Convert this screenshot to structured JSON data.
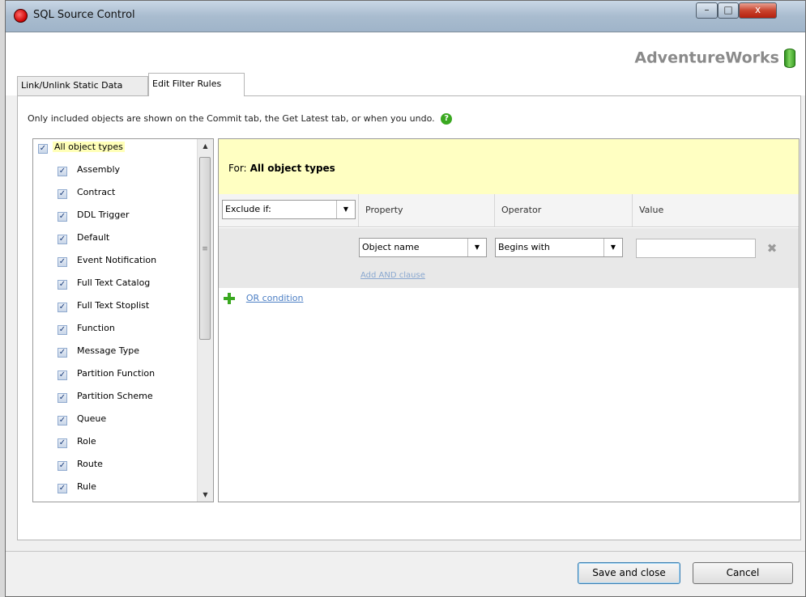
{
  "window": {
    "title": "SQL Source Control",
    "minimize": "–",
    "maximize": "□",
    "close": "x"
  },
  "header": {
    "database_name": "AdventureWorks",
    "icon": "database-cylinder-icon"
  },
  "tabs": [
    {
      "label": "Link/Unlink Static Data",
      "active": false
    },
    {
      "label": "Edit Filter Rules",
      "active": true
    }
  ],
  "info": {
    "text": "Only included objects are shown on the Commit tab, the Get Latest tab, or when you undo.",
    "help_icon_glyph": "?"
  },
  "object_types": {
    "check_glyph": "✓",
    "all": {
      "label": "All object types",
      "checked": true
    },
    "items": [
      {
        "label": "Assembly",
        "checked": true
      },
      {
        "label": "Contract",
        "checked": true
      },
      {
        "label": "DDL Trigger",
        "checked": true
      },
      {
        "label": "Default",
        "checked": true
      },
      {
        "label": "Event Notification",
        "checked": true
      },
      {
        "label": "Full Text Catalog",
        "checked": true
      },
      {
        "label": "Full Text Stoplist",
        "checked": true
      },
      {
        "label": "Function",
        "checked": true
      },
      {
        "label": "Message Type",
        "checked": true
      },
      {
        "label": "Partition Function",
        "checked": true
      },
      {
        "label": "Partition Scheme",
        "checked": true
      },
      {
        "label": "Queue",
        "checked": true
      },
      {
        "label": "Role",
        "checked": true
      },
      {
        "label": "Route",
        "checked": true
      },
      {
        "label": "Rule",
        "checked": true
      }
    ],
    "scroll_up": "▲",
    "scroll_down": "▼",
    "scroll_grip": "≡"
  },
  "rules": {
    "for_label": "For:",
    "for_value": "All object types",
    "mode": "Exclude if:",
    "columns": [
      "Property",
      "Operator",
      "Value"
    ],
    "condition": {
      "property": "Object name",
      "operator": "Begins with",
      "value": ""
    },
    "add_and_clause": "Add AND clause",
    "or_condition": "OR condition",
    "dropdown_arrow": "▼",
    "delete_glyph": "✖"
  },
  "footer": {
    "save_label": "Save and close",
    "cancel_label": "Cancel"
  },
  "colors": {
    "for_bar": "#ffffc2",
    "highlight": "#ffffb8",
    "link": "#4b7ec4",
    "accent_green": "#3aa820",
    "close_red": "#c9442e"
  }
}
